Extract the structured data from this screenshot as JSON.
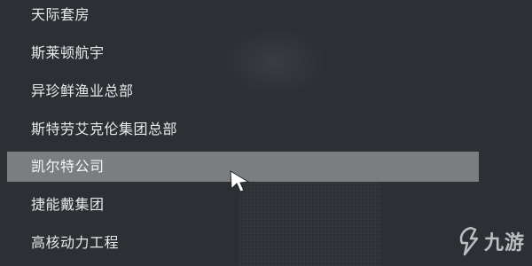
{
  "menu": {
    "items": [
      {
        "label": "天际套房",
        "selected": false
      },
      {
        "label": "斯莱顿航宇",
        "selected": false
      },
      {
        "label": "异珍鲜渔业总部",
        "selected": false
      },
      {
        "label": "斯特劳艾克伦集团总部",
        "selected": false
      },
      {
        "label": "凯尔特公司",
        "selected": true
      },
      {
        "label": "捷能戴集团",
        "selected": false
      },
      {
        "label": "高核动力工程",
        "selected": false
      }
    ]
  },
  "watermark": {
    "text": "九游"
  },
  "colors": {
    "background": "#2c3035",
    "selected_bg": "#7b7e81",
    "text": "#e6e8ea"
  }
}
